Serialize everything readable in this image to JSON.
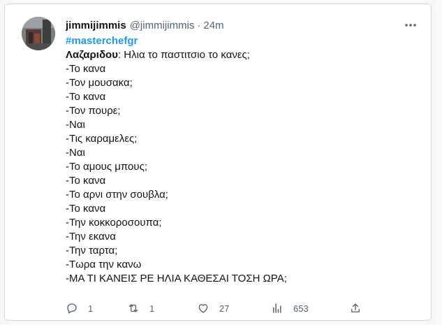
{
  "tweet": {
    "display_name": "jimmijimmis",
    "handle": "@jimmijimmis",
    "separator": "·",
    "time": "24m",
    "hashtag": "#masterchefgr",
    "first_line_bold": "Λαζαριδου",
    "first_line_rest": ": Ηλια το παστιτσιο το κανες;",
    "lines": [
      "-Το κανα",
      "-Τον μουσακα;",
      "-Το κανα",
      "-Τον πουρε;",
      "-Ναι",
      "-Τις καραμελες;",
      "-Ναι",
      "-Το αμους μπους;",
      "-Το κανα",
      "-Το αρνι στην σουβλα;",
      "-Το κανα",
      "-Την κοκκοροσουπα;",
      "-Την εκανα",
      "-Την ταρτα;",
      "-Τωρα την κανω",
      "-ΜΑ ΤΙ ΚΑΝΕΙΣ ΡΕ ΗΛΙΑ ΚΑΘΕΣΑΙ ΤΟΣΗ ΩΡΑ;"
    ]
  },
  "actions": {
    "replies": "1",
    "retweets": "1",
    "likes": "27",
    "views": "653"
  },
  "icons": {
    "more": "more-icon",
    "reply": "reply-icon",
    "retweet": "retweet-icon",
    "like": "like-icon",
    "views": "views-icon",
    "share": "share-icon"
  },
  "colors": {
    "hashtag": "#1d9bf0",
    "secondary_text": "#536471",
    "primary_text": "#0f1419"
  }
}
